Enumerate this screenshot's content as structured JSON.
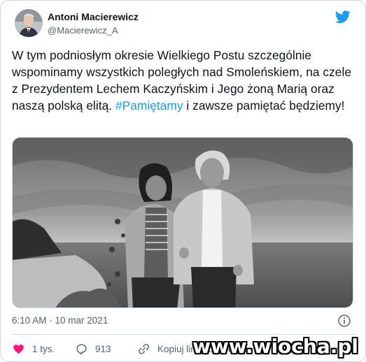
{
  "author": {
    "display_name": "Antoni Macierewicz",
    "handle": "@Macierewicz_A"
  },
  "tweet": {
    "text_before": "W tym podniosłym okresie Wielkiego Postu szczególnie wspominamy wszystkich poległych nad Smoleńskiem, na czele z Prezydentem Lechem Kaczyńskim i Jego żoną Marią oraz naszą polską elitą. ",
    "hashtag": "#Pamiętamy",
    "text_after": " i zawsze pamiętać będziemy!"
  },
  "meta": {
    "timestamp": "6:10 AM · 10 mar 2021"
  },
  "actions": {
    "likes": "1 tys.",
    "replies": "913",
    "copy_link": "Kopiuj link do Tweeta"
  },
  "watermark": "www.wiocha.pl",
  "colors": {
    "accent": "#1d9bf0",
    "text": "#0f1419",
    "secondary": "#536471",
    "like": "#f91880"
  }
}
